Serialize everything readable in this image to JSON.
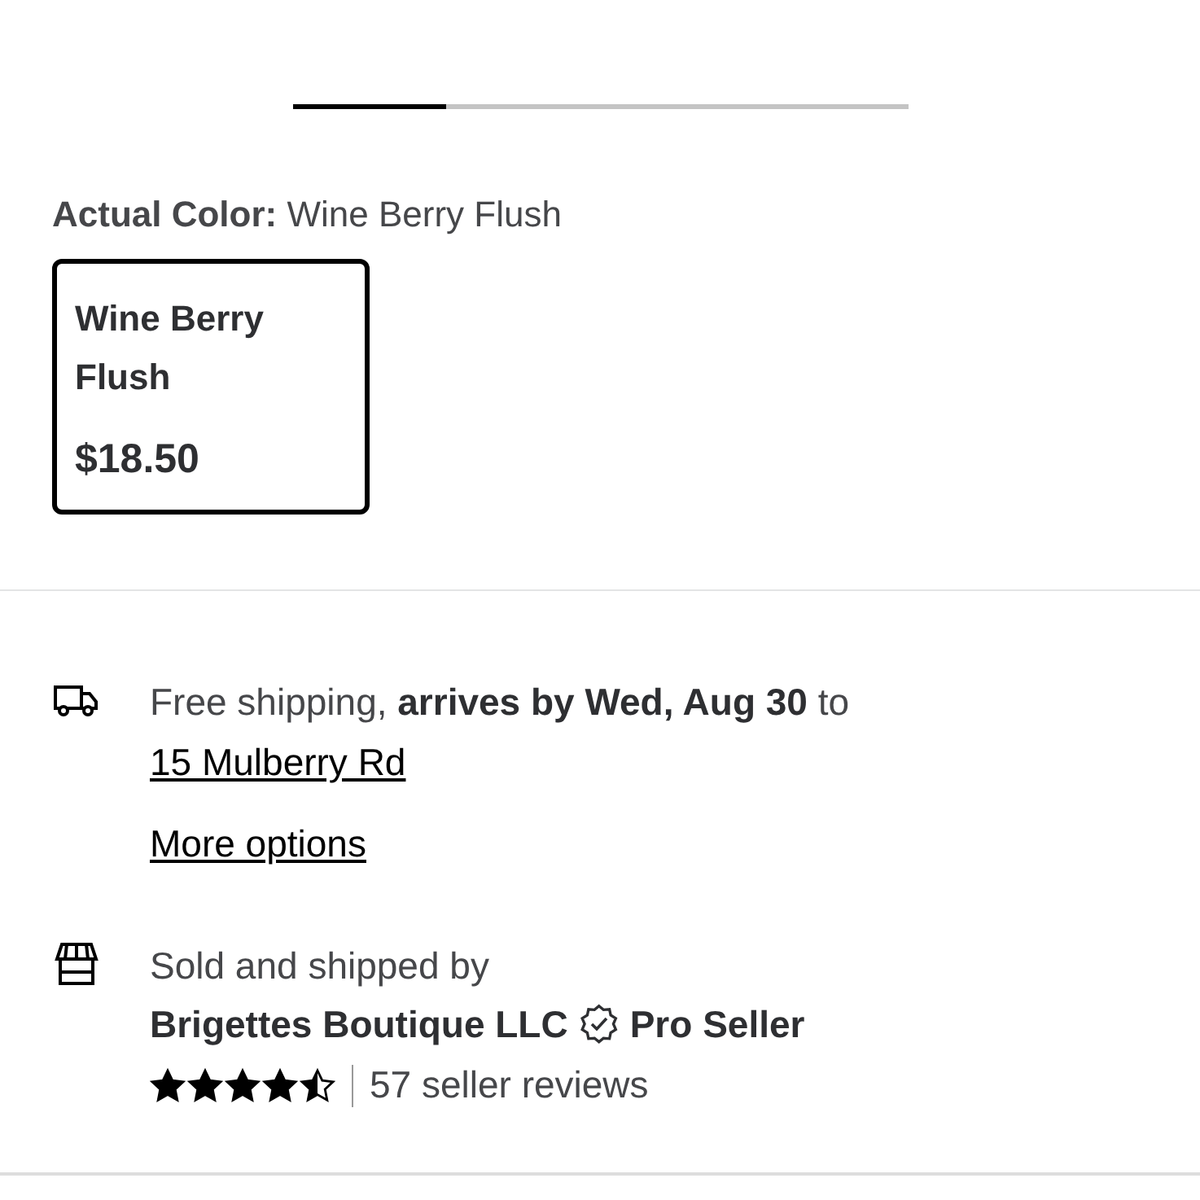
{
  "carousel": {
    "level": 0.25
  },
  "color_picker": {
    "label": "Actual Color:",
    "value": "Wine Berry Flush",
    "swatches": [
      {
        "name": "Wine Berry Flush",
        "price": "$18.50",
        "selected": true
      }
    ]
  },
  "shipping": {
    "text": "Free shipping, **arrives by Wed, Aug 30** to ",
    "address": "15 Mulberry Rd",
    "more_link": "More options"
  },
  "seller": {
    "intro": "Sold and shipped by",
    "name": "Brigettes Boutique LLC",
    "badge": "Pro Seller",
    "stars": 4.5,
    "reviews": "57 seller reviews"
  }
}
